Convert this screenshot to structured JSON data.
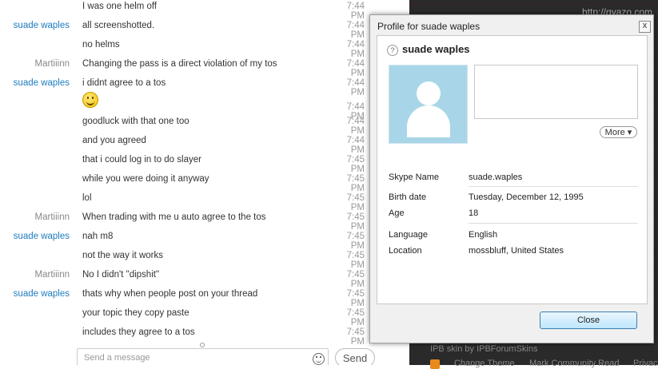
{
  "chat": {
    "rows": [
      {
        "sender": "",
        "sender_type": "",
        "text": "I was one helm off",
        "time": "7:44 PM"
      },
      {
        "sender": "suade waples",
        "sender_type": "s",
        "text": "all screenshotted.",
        "time": "7:44 PM"
      },
      {
        "sender": "",
        "sender_type": "",
        "text": "no helms",
        "time": "7:44 PM"
      },
      {
        "sender": "Martiiinn",
        "sender_type": "m",
        "text": "Changing the pass is a direct violation of my tos",
        "time": "7:44 PM"
      },
      {
        "sender": "suade waples",
        "sender_type": "s",
        "text": "i didnt agree to a tos",
        "time": "7:44 PM"
      },
      {
        "sender": "",
        "sender_type": "",
        "text": "",
        "time": "7:44 PM",
        "emoji": "smiley-emoticon"
      },
      {
        "sender": "",
        "sender_type": "",
        "text": "goodluck with that one too",
        "time": "7:44 PM"
      },
      {
        "sender": "",
        "sender_type": "",
        "text": "and you agreed",
        "time": "7:44 PM"
      },
      {
        "sender": "",
        "sender_type": "",
        "text": "that i could log in to do slayer",
        "time": "7:45 PM"
      },
      {
        "sender": "",
        "sender_type": "",
        "text": "while you were doing it anyway",
        "time": "7:45 PM"
      },
      {
        "sender": "",
        "sender_type": "",
        "text": "lol",
        "time": "7:45 PM"
      },
      {
        "sender": "Martiiinn",
        "sender_type": "m",
        "text": "When trading with me u auto agree to the tos",
        "time": "7:45 PM"
      },
      {
        "sender": "suade waples",
        "sender_type": "s",
        "text": "nah m8",
        "time": "7:45 PM"
      },
      {
        "sender": "",
        "sender_type": "",
        "text": "not the way it works",
        "time": "7:45 PM"
      },
      {
        "sender": "Martiiinn",
        "sender_type": "m",
        "text": "No I didn't \"dipshit\"",
        "time": "7:45 PM"
      },
      {
        "sender": "suade waples",
        "sender_type": "s",
        "text": "thats why when people post on your thread",
        "time": "7:45 PM"
      },
      {
        "sender": "",
        "sender_type": "",
        "text": "your topic they copy paste",
        "time": "7:45 PM"
      },
      {
        "sender": "",
        "sender_type": "",
        "text": "includes they agree to a tos",
        "time": "7:45 PM"
      }
    ],
    "input_placeholder": "Send a message",
    "send_label": "Send"
  },
  "background": {
    "gyazo_link": "http://gyazo.com",
    "ipb_text": "IPB skin by IPBForumSkins",
    "footer_links": [
      "Change Theme",
      "Mark Community Read",
      "Privac"
    ]
  },
  "profile_dialog": {
    "title": "Profile for suade waples",
    "close_glyph": "x",
    "name": "suade waples",
    "status_glyph": "?",
    "more_label": "More ▾",
    "skype_name_label": "Skype Name",
    "skype_name_value": "suade.waples",
    "birth_date_label": "Birth date",
    "birth_date_value": "Tuesday, December 12, 1995",
    "age_label": "Age",
    "age_value": "18",
    "language_label": "Language",
    "language_value": "English",
    "location_label": "Location",
    "location_value": "mossbluff, United States",
    "close_button_label": "Close"
  },
  "colors": {
    "sender_suade": "#1c7cbf",
    "sender_martiiinn": "#888888",
    "avatar_bg": "#a8d6e8",
    "close_button_border": "#3c7fb1"
  }
}
